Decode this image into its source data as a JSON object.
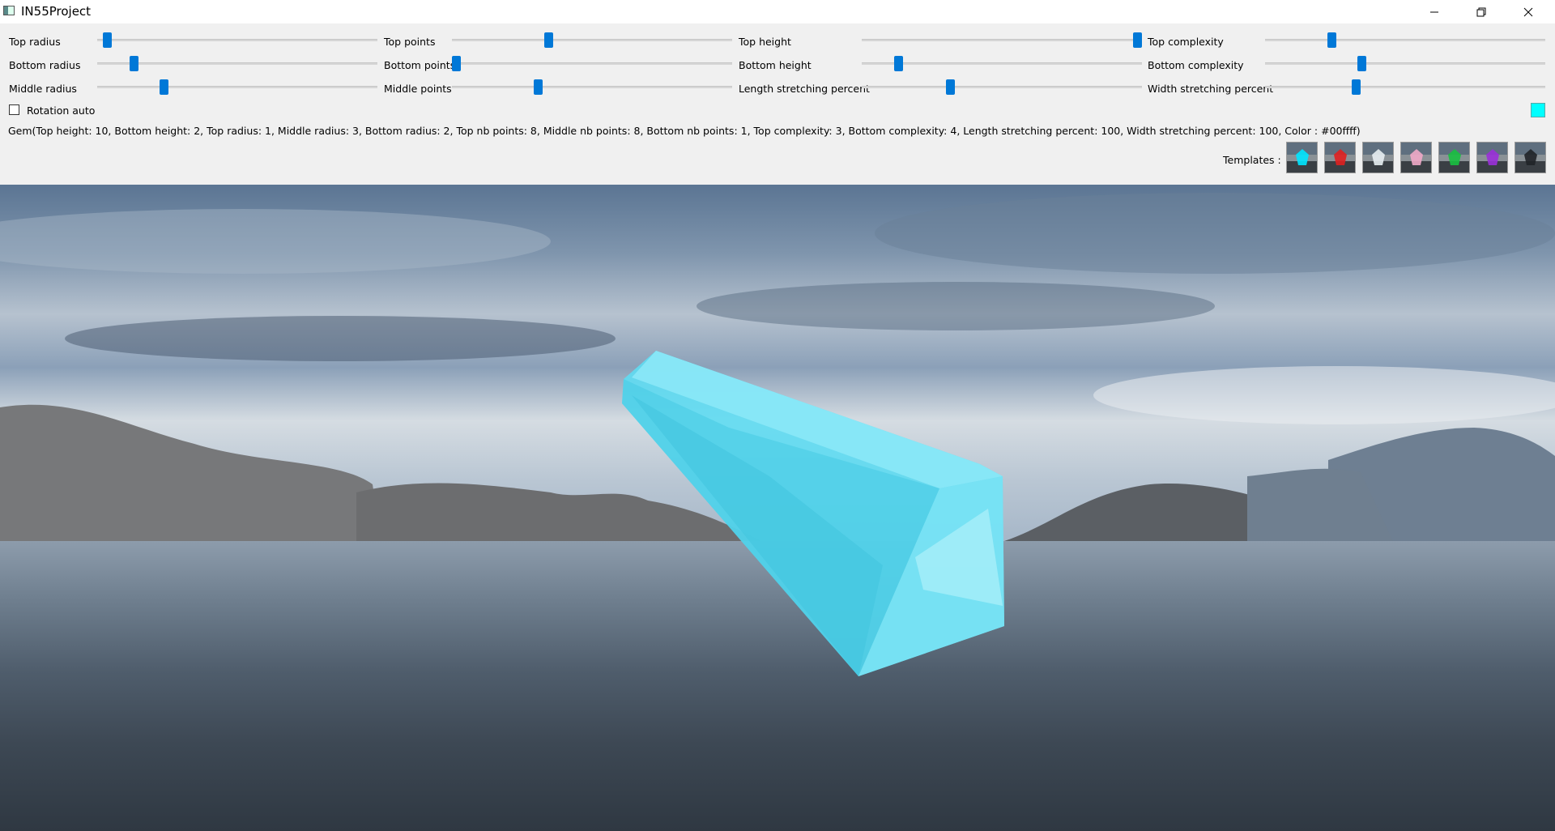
{
  "window": {
    "title": "IN55Project",
    "buttons": {
      "minimize": "–",
      "restore": "❐",
      "close": "✕"
    }
  },
  "sliders": [
    {
      "key": "top-radius",
      "label": "Top radius",
      "value_fraction": 0.02
    },
    {
      "key": "top-points",
      "label": "Top points",
      "value_fraction": 0.34
    },
    {
      "key": "top-height",
      "label": "Top height",
      "value_fraction": 1.0
    },
    {
      "key": "top-complexity",
      "label": "Top complexity",
      "value_fraction": 0.23
    },
    {
      "key": "bottom-radius",
      "label": "Bottom radius",
      "value_fraction": 0.12
    },
    {
      "key": "bottom-points",
      "label": "Bottom points",
      "value_fraction": 0.0
    },
    {
      "key": "bottom-height",
      "label": "Bottom height",
      "value_fraction": 0.12
    },
    {
      "key": "bottom-complexity",
      "label": "Bottom complexity",
      "value_fraction": 0.34
    },
    {
      "key": "middle-radius",
      "label": "Middle radius",
      "value_fraction": 0.23
    },
    {
      "key": "middle-points",
      "label": "Middle points",
      "value_fraction": 0.3
    },
    {
      "key": "length-stretching-percent",
      "label": "Length stretching percent",
      "value_fraction": 0.31
    },
    {
      "key": "width-stretching-percent",
      "label": "Width stretching percent",
      "value_fraction": 0.32
    }
  ],
  "rotation_checkbox": {
    "label": "Rotation auto",
    "checked": false
  },
  "color_swatch": "#00ffff",
  "gem_info": "Gem(Top height: 10, Bottom height: 2, Top radius: 1, Middle radius: 3, Bottom radius: 2, Top nb points: 8, Middle nb points: 8, Bottom nb points: 1, Top complexity: 3, Bottom complexity: 4, Length stretching percent: 100, Width stretching percent: 100, Color : #00ffff)",
  "templates": {
    "label": "Templates :",
    "items": [
      {
        "name": "cyan-gem",
        "color": "#00e5ff"
      },
      {
        "name": "red-gem",
        "color": "#e02020"
      },
      {
        "name": "white-gem",
        "color": "#e8eef2"
      },
      {
        "name": "pink-gem",
        "color": "#f0a8c8"
      },
      {
        "name": "green-gem",
        "color": "#18c040"
      },
      {
        "name": "purple-gem",
        "color": "#9a30d8"
      },
      {
        "name": "black-gem",
        "color": "#202428"
      }
    ]
  },
  "scene": {
    "gem_color": "#4fdcf2"
  }
}
